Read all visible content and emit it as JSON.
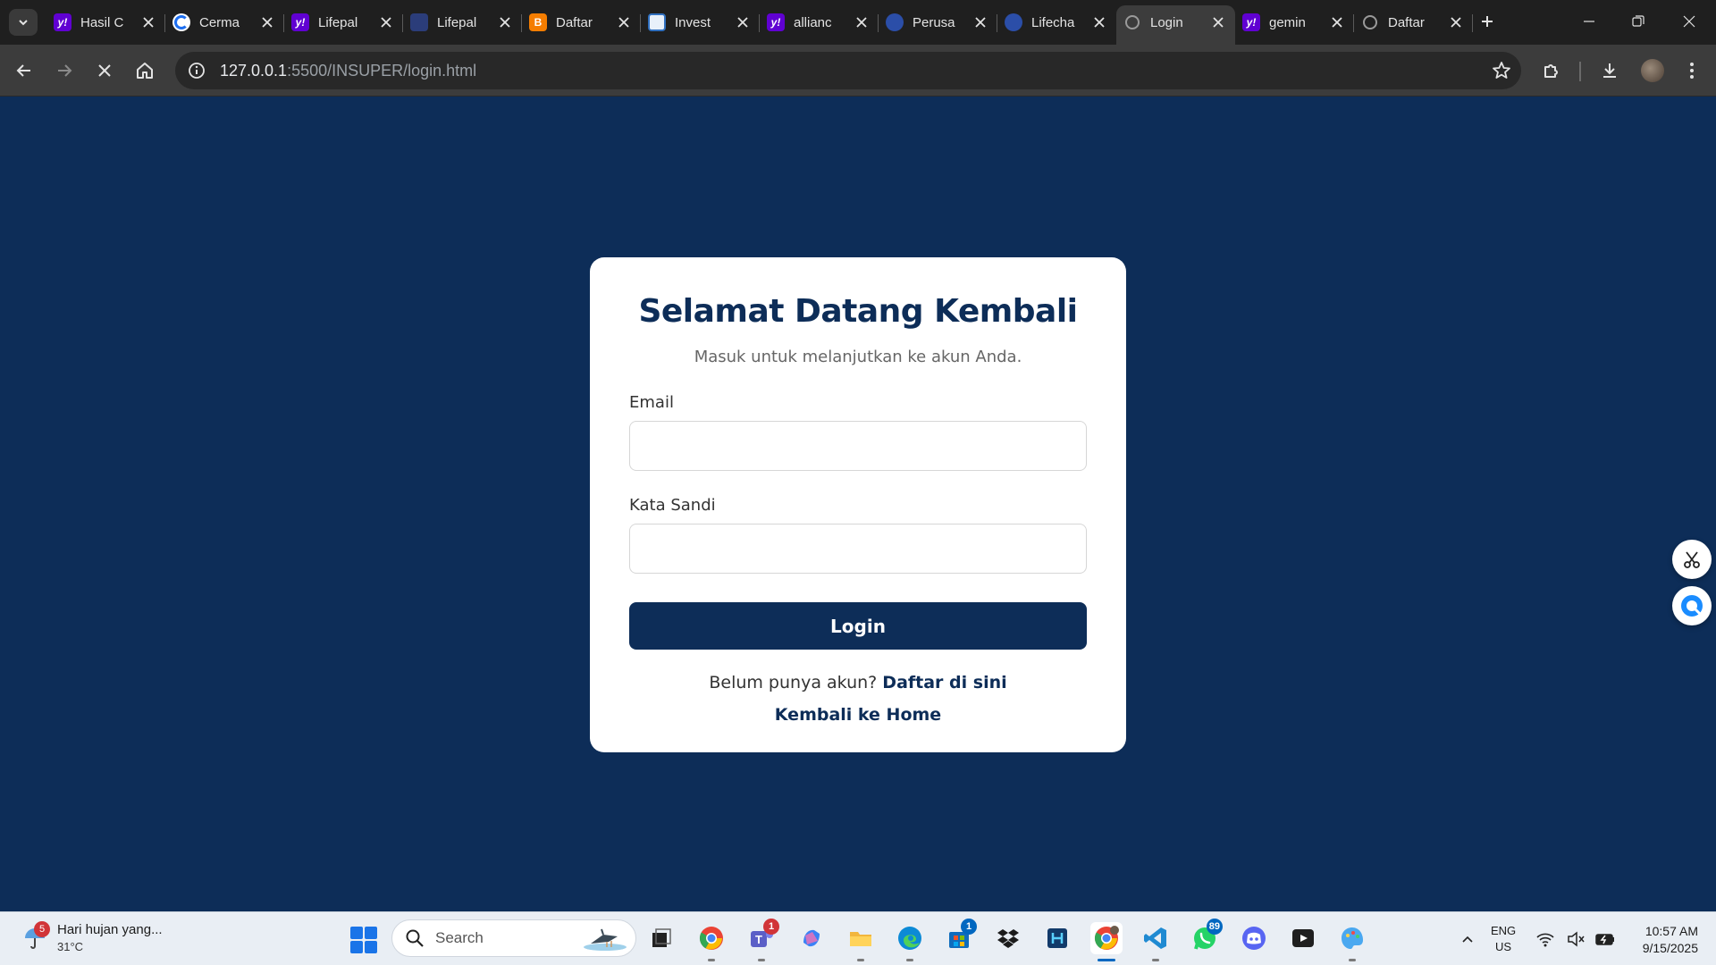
{
  "browser": {
    "tabs": [
      {
        "title": "Hasil C",
        "favicon": "yahoo-favicon",
        "fav_text": "y!"
      },
      {
        "title": "Cerma",
        "favicon": "cermati-favicon",
        "fav_text": ""
      },
      {
        "title": "Lifepal",
        "favicon": "yahoo-favicon",
        "fav_text": "y!"
      },
      {
        "title": "Lifepal",
        "favicon": "lifepal-favicon",
        "fav_text": ""
      },
      {
        "title": "Daftar",
        "favicon": "blogger-favicon",
        "fav_text": "B"
      },
      {
        "title": "Invest",
        "favicon": "investment-favicon",
        "fav_text": ""
      },
      {
        "title": "allianc",
        "favicon": "yahoo-favicon",
        "fav_text": "y!"
      },
      {
        "title": "Perusa",
        "favicon": "allianz-favicon",
        "fav_text": ""
      },
      {
        "title": "Lifecha",
        "favicon": "allianz-favicon",
        "fav_text": ""
      },
      {
        "title": "Login",
        "favicon": "globe-favicon",
        "fav_text": ""
      },
      {
        "title": "gemin",
        "favicon": "yahoo-favicon",
        "fav_text": "y!"
      },
      {
        "title": "Daftar",
        "favicon": "globe-favicon",
        "fav_text": ""
      }
    ],
    "active_tab_index": 9,
    "address": {
      "host": "127.0.0.1",
      "path": ":5500/INSUPER/login.html"
    }
  },
  "login": {
    "title": "Selamat Datang Kembali",
    "subtitle": "Masuk untuk melanjutkan ke akun Anda.",
    "email_label": "Email",
    "email_value": "",
    "password_label": "Kata Sandi",
    "password_value": "",
    "submit_label": "Login",
    "register_prompt": "Belum punya akun?",
    "register_link": "Daftar di sini",
    "home_link": "Kembali ke Home"
  },
  "taskbar": {
    "weather": {
      "text": "Hari hujan yang...",
      "temp": "31°C",
      "badge": "5"
    },
    "search_placeholder": "Search",
    "badges": {
      "teams": "1",
      "store": "1",
      "whatsapp": "89"
    },
    "lang": {
      "line1": "ENG",
      "line2": "US"
    },
    "clock": {
      "time": "10:57 AM",
      "date": "9/15/2025"
    }
  },
  "colors": {
    "page_bg": "#0d2d58",
    "card_bg": "#ffffff",
    "accent": "#0d2d58",
    "tabstrip_bg": "#1f1f1f",
    "toolbar_bg": "#3c3c3c",
    "taskbar_bg": "#e9eef4"
  }
}
